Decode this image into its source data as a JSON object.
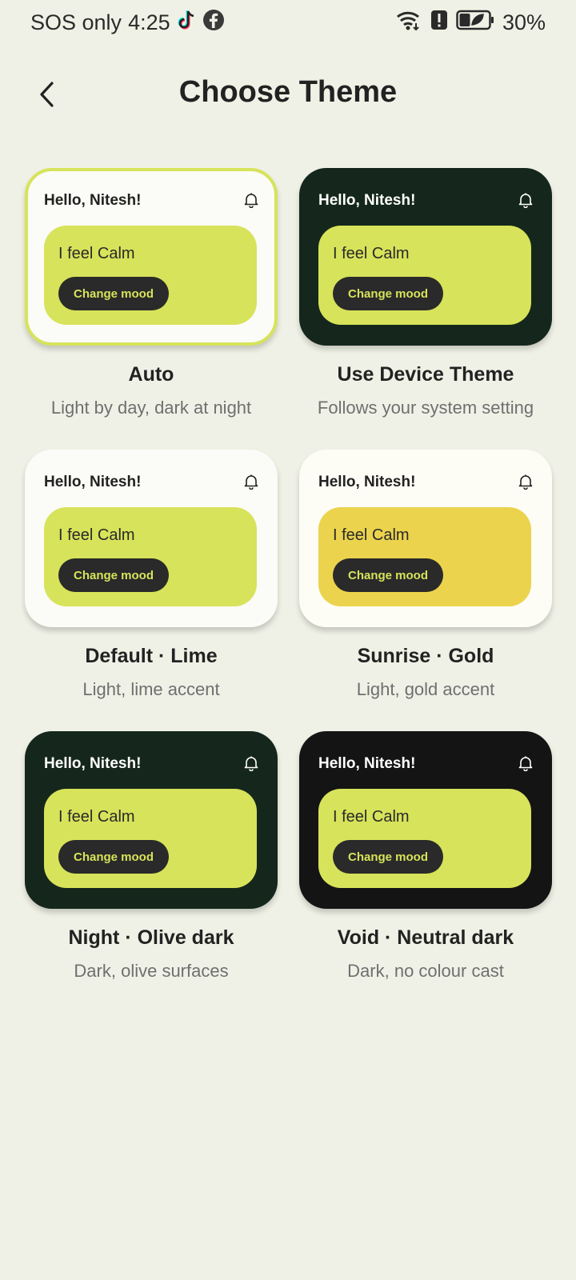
{
  "status_bar": {
    "carrier": "SOS only",
    "time": "4:25",
    "battery": "30%",
    "icons": [
      "tiktok-icon",
      "facebook-icon",
      "wifi-icon",
      "alert-icon",
      "battery-icon"
    ]
  },
  "header": {
    "title": "Choose Theme",
    "back_icon": "chevron-left-icon"
  },
  "themes": [
    {
      "name": "Auto",
      "description": "Light by day, dark at night",
      "selected": true,
      "greeting": "Hello, Nitesh!",
      "mood": "I feel Calm",
      "button": "Change mood",
      "colors": {
        "card": "#fbfbf7",
        "text": "#222222",
        "accent": "#d7e35a",
        "border": "#d7e35a"
      }
    },
    {
      "name": "Use Device Theme",
      "description": "Follows your system setting",
      "selected": false,
      "greeting": "Hello, Nitesh!",
      "mood": "I feel Calm",
      "button": "Change mood",
      "colors": {
        "card": "#15271c",
        "text": "#ffffff",
        "accent": "#d7e35a"
      }
    },
    {
      "name": "Default · Lime",
      "description": "Light, lime accent",
      "selected": false,
      "greeting": "Hello, Nitesh!",
      "mood": "I feel Calm",
      "button": "Change mood",
      "colors": {
        "card": "#fbfbf7",
        "text": "#222222",
        "accent": "#d7e35a"
      }
    },
    {
      "name": "Sunrise · Gold",
      "description": "Light, gold accent",
      "selected": false,
      "greeting": "Hello, Nitesh!",
      "mood": "I feel Calm",
      "button": "Change mood",
      "colors": {
        "card": "#fdfcf5",
        "text": "#222222",
        "accent": "#ebd34d"
      }
    },
    {
      "name": "Night · Olive dark",
      "description": "Dark, olive surfaces",
      "selected": false,
      "greeting": "Hello, Nitesh!",
      "mood": "I feel Calm",
      "button": "Change mood",
      "colors": {
        "card": "#15271c",
        "text": "#ffffff",
        "accent": "#d7e35a"
      }
    },
    {
      "name": "Void · Neutral dark",
      "description": "Dark, no colour cast",
      "selected": false,
      "greeting": "Hello, Nitesh!",
      "mood": "I feel Calm",
      "button": "Change mood",
      "colors": {
        "card": "#141414",
        "text": "#ffffff",
        "accent": "#d7e35a"
      }
    }
  ]
}
